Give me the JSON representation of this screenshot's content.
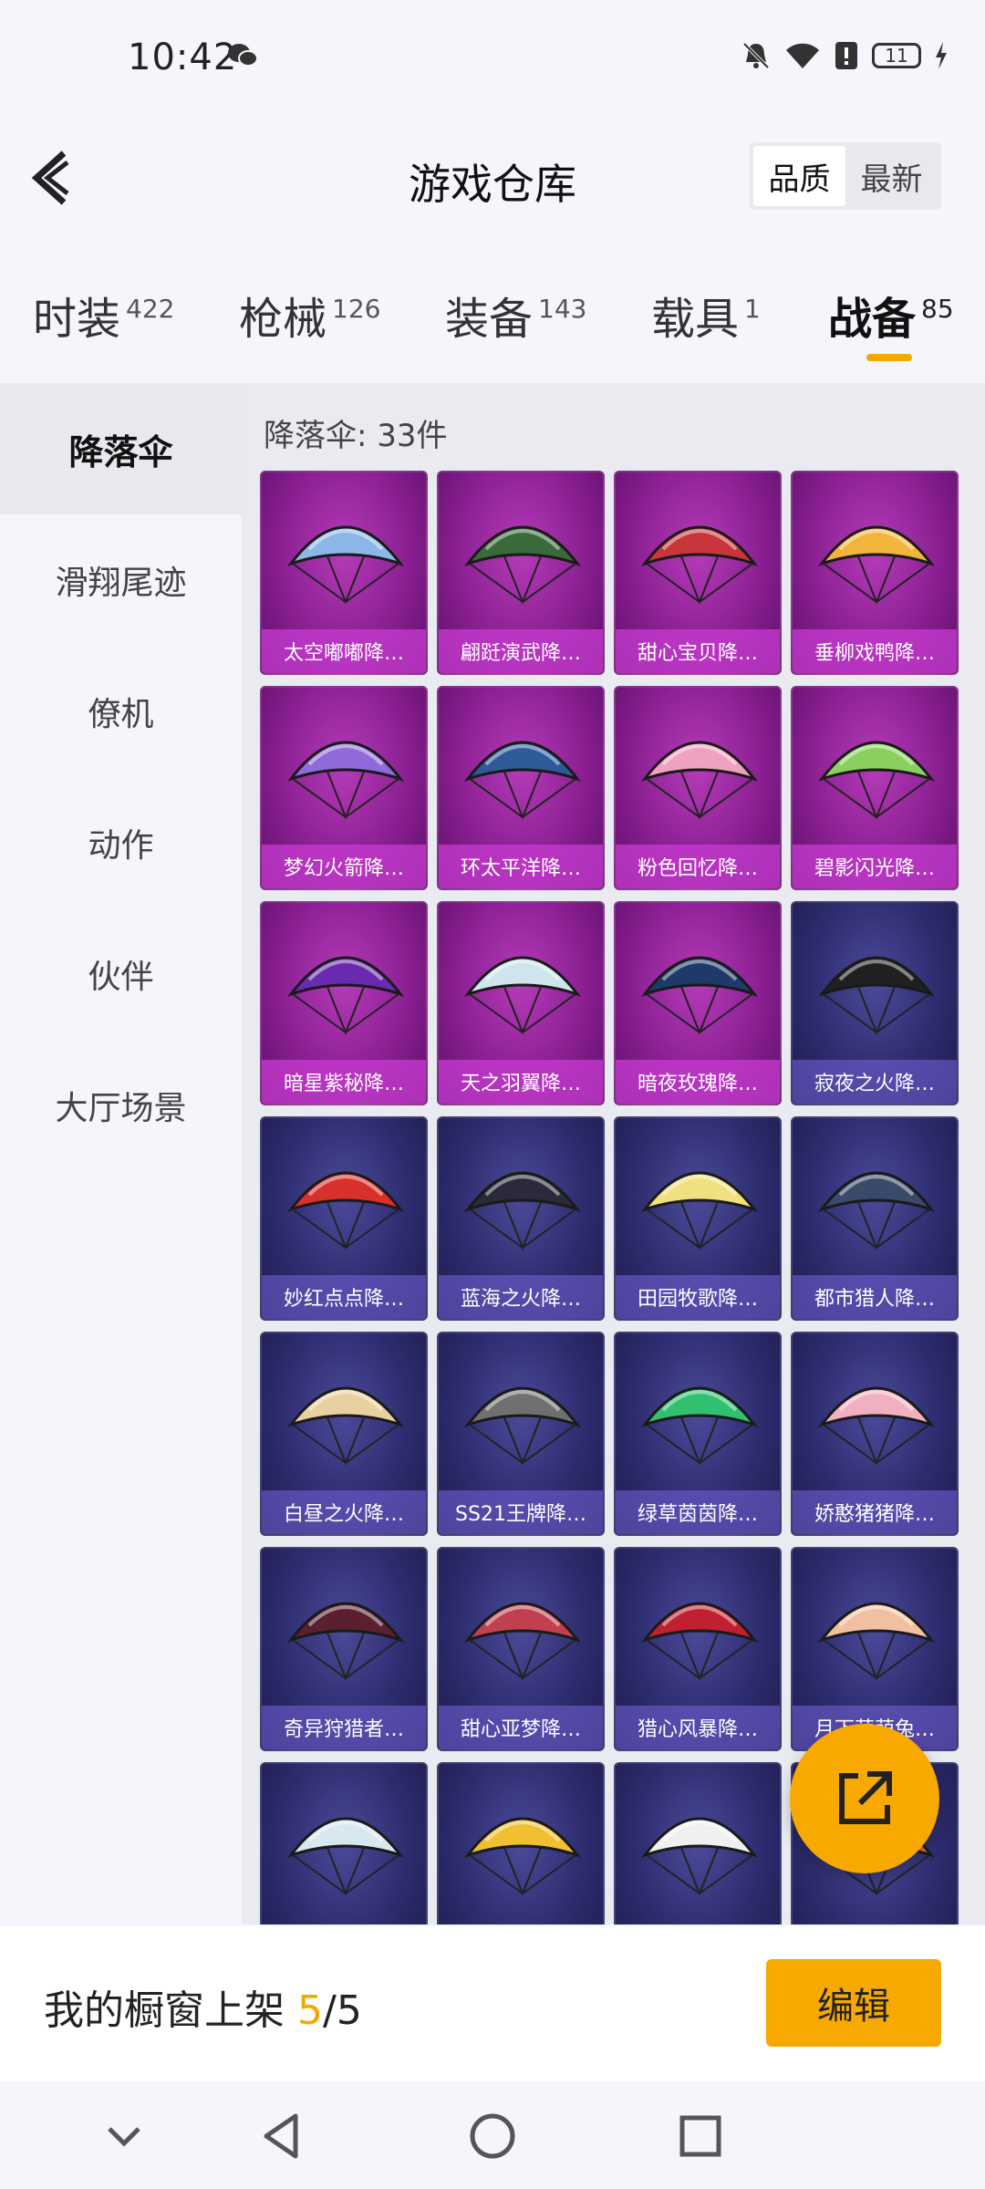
{
  "status_bar": {
    "time": "10:42",
    "battery": "11"
  },
  "header": {
    "title": "游戏仓库",
    "sort_options": [
      "品质",
      "最新"
    ],
    "active_sort": "品质"
  },
  "category_tabs": [
    {
      "label": "时装",
      "count": "422"
    },
    {
      "label": "枪械",
      "count": "126"
    },
    {
      "label": "装备",
      "count": "143"
    },
    {
      "label": "载具",
      "count": "1"
    },
    {
      "label": "战备",
      "count": "85"
    }
  ],
  "active_tab": "战备",
  "sidebar": {
    "items": [
      "降落伞",
      "滑翔尾迹",
      "僚机",
      "动作",
      "伙伴",
      "大厅场景"
    ],
    "active": "降落伞"
  },
  "content": {
    "count_label": "降落伞: 33件",
    "items": [
      {
        "name": "太空嘟嘟降…",
        "quality": "purple",
        "color": "#8ab6e8"
      },
      {
        "name": "翩跹演武降…",
        "quality": "purple",
        "color": "#3a6a3a"
      },
      {
        "name": "甜心宝贝降…",
        "quality": "purple",
        "color": "#c8353a"
      },
      {
        "name": "垂柳戏鸭降…",
        "quality": "purple",
        "color": "#f2b43a"
      },
      {
        "name": "梦幻火箭降…",
        "quality": "purple",
        "color": "#8f6ad8"
      },
      {
        "name": "环太平洋降…",
        "quality": "purple",
        "color": "#2f5a9a"
      },
      {
        "name": "粉色回忆降…",
        "quality": "purple",
        "color": "#f0a0c0"
      },
      {
        "name": "碧影闪光降…",
        "quality": "purple",
        "color": "#8ad060"
      },
      {
        "name": "暗星紫秘降…",
        "quality": "purple",
        "color": "#6a2ab0"
      },
      {
        "name": "天之羽翼降…",
        "quality": "purple",
        "color": "#cfe4ec"
      },
      {
        "name": "暗夜玫瑰降…",
        "quality": "purple",
        "color": "#1f3a6a"
      },
      {
        "name": "寂夜之火降…",
        "quality": "blue",
        "color": "#202020"
      },
      {
        "name": "妙红点点降…",
        "quality": "blue",
        "color": "#d8302a"
      },
      {
        "name": "蓝海之火降…",
        "quality": "blue",
        "color": "#2a2a3a"
      },
      {
        "name": "田园牧歌降…",
        "quality": "blue",
        "color": "#f0e080"
      },
      {
        "name": "都市猎人降…",
        "quality": "blue",
        "color": "#3a4a6a"
      },
      {
        "name": "白昼之火降…",
        "quality": "blue",
        "color": "#e8d0a0"
      },
      {
        "name": "SS21王牌降…",
        "quality": "blue",
        "color": "#707070"
      },
      {
        "name": "绿草茵茵降…",
        "quality": "blue",
        "color": "#30c070"
      },
      {
        "name": "娇憨猪猪降…",
        "quality": "blue",
        "color": "#f0b0c0"
      },
      {
        "name": "奇异狩猎者…",
        "quality": "blue",
        "color": "#5a2030"
      },
      {
        "name": "甜心亚梦降…",
        "quality": "blue",
        "color": "#c04050"
      },
      {
        "name": "猎心风暴降…",
        "quality": "blue",
        "color": "#c02030"
      },
      {
        "name": "月下萌萌兔…",
        "quality": "blue",
        "color": "#f0c0a0"
      },
      {
        "name": "",
        "quality": "blue",
        "color": "#d8e8f0"
      },
      {
        "name": "",
        "quality": "blue",
        "color": "#f0c030"
      },
      {
        "name": "",
        "quality": "blue",
        "color": "#f0f0f0"
      },
      {
        "name": "",
        "quality": "blue",
        "color": "#f07030"
      }
    ]
  },
  "bottom_bar": {
    "label": "我的橱窗上架",
    "current": "5",
    "total": "/5",
    "edit_label": "编辑"
  },
  "colors": {
    "accent": "#f7a900",
    "purple_quality": "#8a1f92",
    "blue_quality": "#2d2c6e"
  }
}
